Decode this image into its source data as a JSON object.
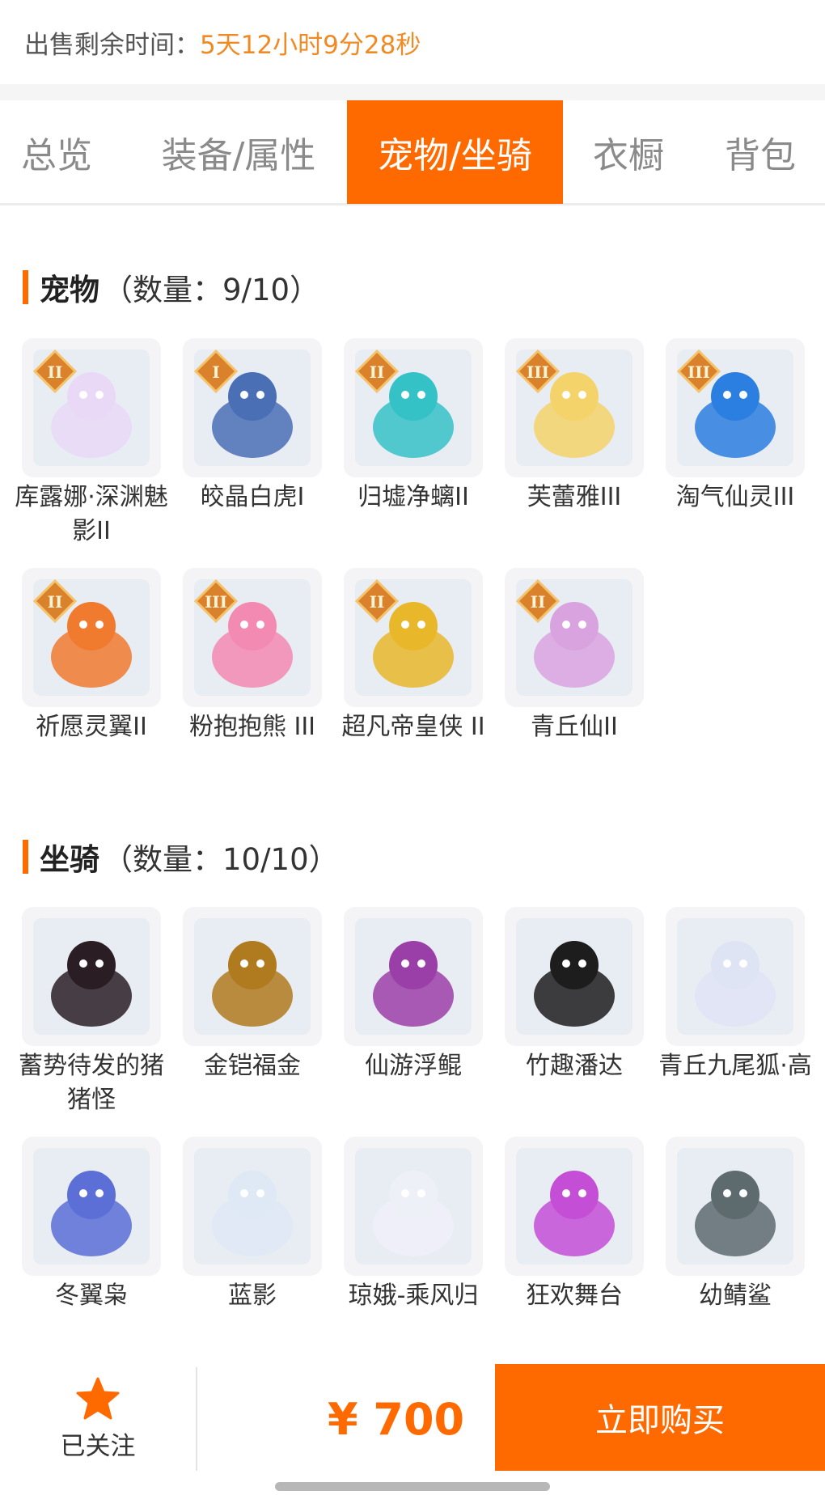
{
  "sale": {
    "label": "出售剩余时间：",
    "remaining": "5天12小时9分28秒"
  },
  "tabs": [
    {
      "label": "总览",
      "active": false
    },
    {
      "label": "装备/属性",
      "active": false
    },
    {
      "label": "宠物/坐骑",
      "active": true
    },
    {
      "label": "衣橱",
      "active": false
    },
    {
      "label": "背包",
      "active": false
    }
  ],
  "pets": {
    "title": "宠物",
    "count": "（数量：9/10）",
    "items": [
      {
        "name": "库露娜·深渊魅影II",
        "icon": "pet-white-hair-girl-icon",
        "tier": "II",
        "color": "#e9d9f7"
      },
      {
        "name": "皎晶白虎Ⅰ",
        "icon": "pet-blue-tiger-icon",
        "tier": "I",
        "color": "#4a6fb5"
      },
      {
        "name": "归墟净螭II",
        "icon": "pet-teal-dragon-icon",
        "tier": "II",
        "color": "#35c2c7"
      },
      {
        "name": "芙蕾雅III",
        "icon": "pet-golden-crown-girl-icon",
        "tier": "III",
        "color": "#f3d36a"
      },
      {
        "name": "淘气仙灵III",
        "icon": "pet-blue-puppy-icon",
        "tier": "III",
        "color": "#2b7fe0"
      },
      {
        "name": "祈愿灵翼II",
        "icon": "pet-eagle-icon",
        "tier": "II",
        "color": "#f07a2e"
      },
      {
        "name": "粉抱抱熊 III",
        "icon": "pet-pink-bear-icon",
        "tier": "III",
        "color": "#f28ab2"
      },
      {
        "name": "超凡帝皇侠 II",
        "icon": "pet-golden-armor-icon",
        "tier": "II",
        "color": "#e8b82a"
      },
      {
        "name": "青丘仙II",
        "icon": "pet-fox-girl-icon",
        "tier": "II",
        "color": "#d9a3e0"
      }
    ]
  },
  "mounts": {
    "title": "坐骑",
    "count": "（数量：10/10）",
    "items": [
      {
        "name": "蓄势待发的猪猪怪",
        "icon": "mount-black-pig-icon",
        "color": "#2a1e24"
      },
      {
        "name": "金铠福金",
        "icon": "mount-golden-fish-icon",
        "color": "#b07a1f"
      },
      {
        "name": "仙游浮鲲",
        "icon": "mount-purple-whale-icon",
        "color": "#9b3fa8"
      },
      {
        "name": "竹趣潘达",
        "icon": "mount-panda-icon",
        "color": "#1d1d1d"
      },
      {
        "name": "青丘九尾狐·高",
        "icon": "mount-white-fox-icon",
        "color": "#dfe4f5"
      },
      {
        "name": "冬翼枭",
        "icon": "mount-owl-icon",
        "color": "#5b6fd6"
      },
      {
        "name": "蓝影",
        "icon": "mount-white-tiger-icon",
        "color": "#dfe9f6"
      },
      {
        "name": "琼娥-乘风归",
        "icon": "mount-fairy-icon",
        "color": "#eef0f8"
      },
      {
        "name": "狂欢舞台",
        "icon": "mount-heart-stage-icon",
        "color": "#c44fd6"
      },
      {
        "name": "幼鲭鲨",
        "icon": "mount-shark-icon",
        "color": "#5d6b6f"
      }
    ]
  },
  "footer": {
    "follow_label": "已关注",
    "price": "¥ 700",
    "buy_label": "立即购买",
    "accent": "#ff6a00"
  }
}
